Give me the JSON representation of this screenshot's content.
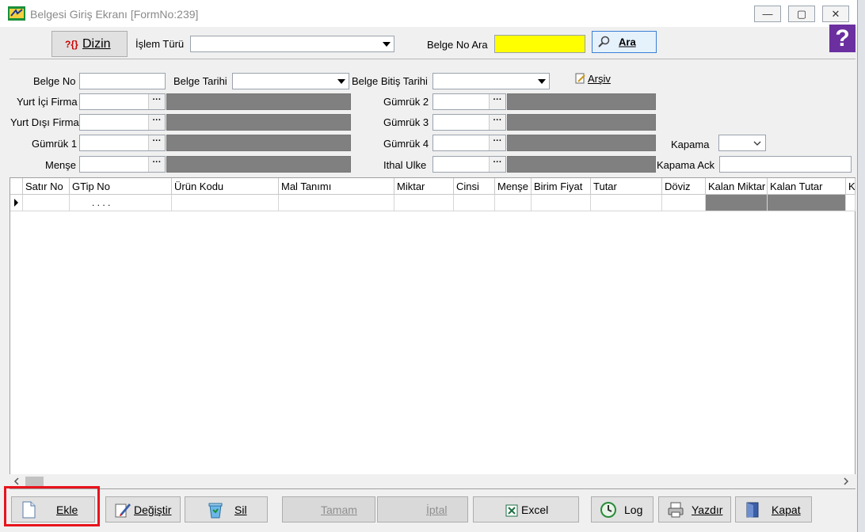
{
  "window": {
    "title": "Belgesi Giriş Ekranı [FormNo:239]",
    "minimize": "—",
    "maximize": "▢",
    "close": "✕"
  },
  "toolbar": {
    "dizin_label": "Dizin",
    "dizin_icon_text": "?{}",
    "islem_turu_label": "İşlem Türü",
    "islem_turu_value": "",
    "belge_no_ara_label": "Belge No Ara",
    "belge_no_ara_value": "",
    "ara_label": "Ara",
    "help_glyph": "?"
  },
  "form": {
    "belge_no_label": "Belge No",
    "belge_tarihi_label": "Belge Tarihi",
    "belge_bitis_tarihi_label": "Belge Bitiş Tarihi",
    "arsiv_label": "Arşiv",
    "yurt_ici_firma_label": "Yurt İçi Firma",
    "yurt_disi_firma_label": "Yurt Dışı Firma",
    "gumruk1_label": "Gümrük 1",
    "mense_label": "Menşe",
    "gumruk2_label": "Gümrük 2",
    "gumruk3_label": "Gümrük 3",
    "gumruk4_label": "Gümrük 4",
    "ithal_ulke_label": "Ithal Ulke",
    "kapama_label": "Kapama",
    "kapama_ack_label": "Kapama Ack",
    "ellipsis": "···"
  },
  "grid": {
    "columns": [
      "Satır No",
      "GTip No",
      "Ürün Kodu",
      "Mal Tanımı",
      "Miktar",
      "Cinsi",
      "Menşe",
      "Birim Fiyat",
      "Tutar",
      "Döviz",
      "Kalan Miktar",
      "Kalan Tutar",
      "K"
    ],
    "row1_gtip": ". . . ."
  },
  "buttons": {
    "ekle": "Ekle",
    "degistir": "Değiştir",
    "sil": "Sil",
    "tamam": "Tamam",
    "iptal": "İptal",
    "excel": "Excel",
    "log": "Log",
    "yazdir": "Yazdır",
    "kapat": "Kapat"
  },
  "colors": {
    "highlight_box": "#e8141c",
    "search_field": "#ffff00",
    "help_bg": "#6b2fa0"
  }
}
